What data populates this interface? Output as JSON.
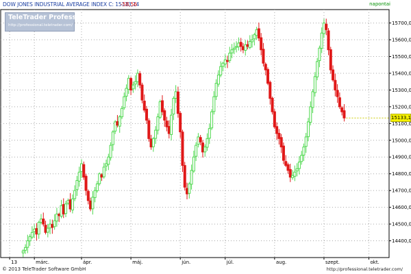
{
  "header": {
    "title": "DOW JONES INDUSTRIAL AVERAGE INDEX C: 15133,14",
    "change": "-58,56",
    "period": "napontai"
  },
  "logo": {
    "title": "TeleTrader Professional",
    "url": "http://professional.teletrader.com/"
  },
  "footer": {
    "copyright": "© 2013 TeleTrader Software GmbH",
    "url": "http://professional.teletrader.com/"
  },
  "colors": {
    "up": "#4ed84e",
    "down": "#e01818",
    "grid": "#a7a7a7",
    "axis": "#000000",
    "last_price_bg": "#f6f200"
  },
  "chart_data": {
    "type": "candlestick",
    "title": "DOW JONES INDUSTRIAL AVERAGE INDEX",
    "last_price": "15133,14",
    "last_price_value": 15133.14,
    "ylim": [
      14300,
      15780
    ],
    "y_ticks": [
      {
        "value": 14400,
        "label": "14400,00"
      },
      {
        "value": 14500,
        "label": "14500,00"
      },
      {
        "value": 14600,
        "label": "14600,00"
      },
      {
        "value": 14700,
        "label": "14700,00"
      },
      {
        "value": 14800,
        "label": "14800,00"
      },
      {
        "value": 14900,
        "label": "14900,00"
      },
      {
        "value": 15000,
        "label": "15000,00"
      },
      {
        "value": 15100,
        "label": "15100,00"
      },
      {
        "value": 15200,
        "label": "15200,00"
      },
      {
        "value": 15300,
        "label": "15300,00"
      },
      {
        "value": 15400,
        "label": "15400,00"
      },
      {
        "value": 15500,
        "label": "15500,00"
      },
      {
        "value": 15600,
        "label": "15600,00"
      },
      {
        "value": 15700,
        "label": "15700,00"
      }
    ],
    "x_ticks": [
      {
        "index": -6,
        "label": "13"
      },
      {
        "index": 5,
        "label": "márc."
      },
      {
        "index": 26,
        "label": "ápr."
      },
      {
        "index": 48,
        "label": "máj."
      },
      {
        "index": 70,
        "label": "jún."
      },
      {
        "index": 90,
        "label": "júl."
      },
      {
        "index": 112,
        "label": "aug."
      },
      {
        "index": 134,
        "label": "szept."
      },
      {
        "index": 154,
        "label": "okt."
      }
    ],
    "x_range": [
      -10,
      163
    ],
    "closes": [
      14340,
      14360,
      14400,
      14425,
      14450,
      14470,
      14440,
      14510,
      14530,
      14500,
      14450,
      14475,
      14500,
      14480,
      14520,
      14560,
      14550,
      14610,
      14560,
      14620,
      14640,
      14590,
      14650,
      14700,
      14760,
      14810,
      14860,
      14780,
      14700,
      14640,
      14590,
      14660,
      14700,
      14740,
      14800,
      14780,
      14840,
      14860,
      14900,
      14970,
      15050,
      15110,
      15090,
      15140,
      15190,
      15260,
      15310,
      15370,
      15300,
      15330,
      15350,
      15400,
      15330,
      15240,
      15180,
      15120,
      15010,
      14960,
      15010,
      15060,
      15140,
      15230,
      15170,
      15120,
      15080,
      15040,
      15150,
      15250,
      15290,
      15160,
      15050,
      14850,
      14720,
      14680,
      14740,
      14820,
      14900,
      14970,
      15020,
      14990,
      14930,
      14960,
      15010,
      15070,
      15170,
      15260,
      15340,
      15390,
      15440,
      15460,
      15480,
      15470,
      15520,
      15540,
      15550,
      15560,
      15580,
      15560,
      15540,
      15570,
      15560,
      15590,
      15600,
      15630,
      15660,
      15610,
      15540,
      15460,
      15420,
      15340,
      15250,
      15170,
      15080,
      15040,
      15010,
      14960,
      14880,
      14850,
      14820,
      14780,
      14790,
      14810,
      14830,
      14870,
      14910,
      14960,
      15020,
      15110,
      15200,
      15290,
      15380,
      15470,
      15550,
      15640,
      15700,
      15660,
      15540,
      15420,
      15360,
      15300,
      15260,
      15200,
      15170,
      15133.14
    ]
  }
}
